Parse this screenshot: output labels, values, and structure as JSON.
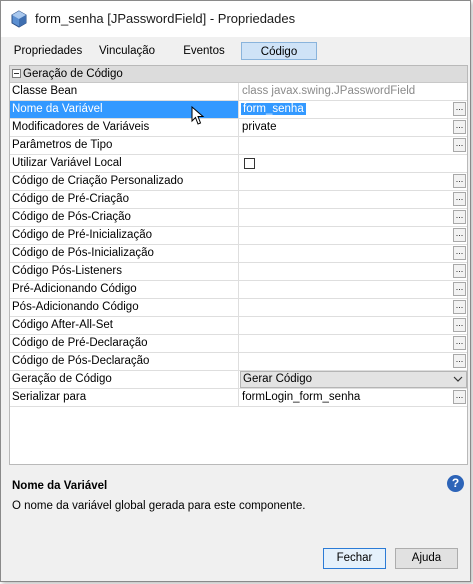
{
  "window": {
    "title": "form_senha [JPasswordField] - Propriedades"
  },
  "tabs": [
    {
      "label": "Propriedades"
    },
    {
      "label": "Vinculação"
    },
    {
      "label": "Eventos"
    },
    {
      "label": "Código"
    }
  ],
  "group": {
    "label": "Geração de Código"
  },
  "rows": [
    {
      "name": "Classe Bean",
      "value": "class javax.swing.JPasswordField"
    },
    {
      "name": "Nome da Variável",
      "value": "form_senha"
    },
    {
      "name": "Modificadores de Variáveis",
      "value": "private"
    },
    {
      "name": "Parâmetros de Tipo",
      "value": ""
    },
    {
      "name": "Utilizar Variável Local",
      "value": ""
    },
    {
      "name": "Código de Criação Personalizado",
      "value": ""
    },
    {
      "name": "Código de Pré-Criação",
      "value": ""
    },
    {
      "name": "Código de Pós-Criação",
      "value": ""
    },
    {
      "name": "Código de Pré-Inicialização",
      "value": ""
    },
    {
      "name": "Código de Pós-Inicialização",
      "value": ""
    },
    {
      "name": "Código Pós-Listeners",
      "value": ""
    },
    {
      "name": "Pré-Adicionando Código",
      "value": ""
    },
    {
      "name": "Pós-Adicionando Código",
      "value": ""
    },
    {
      "name": "Código After-All-Set",
      "value": ""
    },
    {
      "name": "Código de Pré-Declaração",
      "value": ""
    },
    {
      "name": "Código de Pós-Declaração",
      "value": ""
    },
    {
      "name": "Geração de Código",
      "value": "Gerar Código"
    },
    {
      "name": "Serializar para",
      "value": "formLogin_form_senha"
    }
  ],
  "ellipsis_label": "...",
  "description": {
    "title": "Nome da Variável",
    "text": "O nome da variável global gerada para este componente."
  },
  "help_label": "?",
  "buttons": {
    "close": "Fechar",
    "help": "Ajuda"
  },
  "colors": {
    "selection": "#3399ff",
    "active_tab": "#cfe3f7",
    "help_icon": "#2d64b8"
  }
}
